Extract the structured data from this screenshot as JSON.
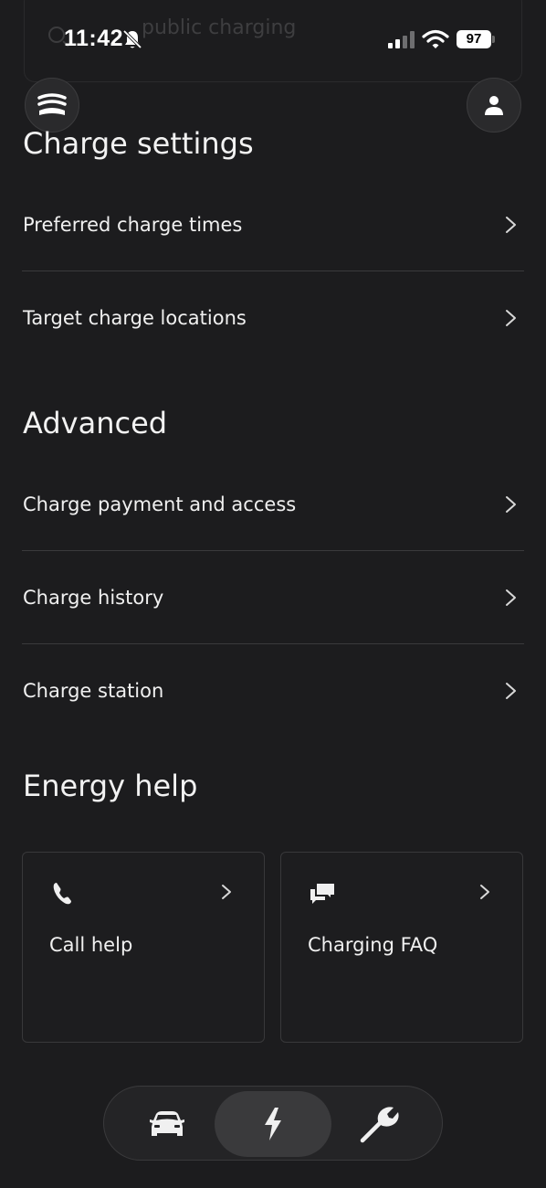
{
  "status_bar": {
    "time": "11:42",
    "battery": "97"
  },
  "search": {
    "placeholder": "public charging"
  },
  "sections": {
    "charge_settings": {
      "title": "Charge settings",
      "items": [
        {
          "label": "Preferred charge times"
        },
        {
          "label": "Target charge locations"
        }
      ]
    },
    "advanced": {
      "title": "Advanced",
      "items": [
        {
          "label": "Charge payment and access"
        },
        {
          "label": "Charge history"
        },
        {
          "label": "Charge station"
        }
      ]
    },
    "energy_help": {
      "title": "Energy help",
      "cards": [
        {
          "label": "Call help",
          "icon": "phone-icon"
        },
        {
          "label": "Charging FAQ",
          "icon": "chat-bubbles-icon"
        }
      ]
    }
  },
  "bottom_nav": {
    "items": [
      {
        "icon": "car-icon",
        "active": false
      },
      {
        "icon": "lightning-icon",
        "active": true
      },
      {
        "icon": "wrench-icon",
        "active": false
      }
    ]
  },
  "colors": {
    "background": "#1c1c1e",
    "text": "#f2f2f2",
    "divider": "#3a3a3c",
    "active_pill": "#3a3a3c"
  }
}
